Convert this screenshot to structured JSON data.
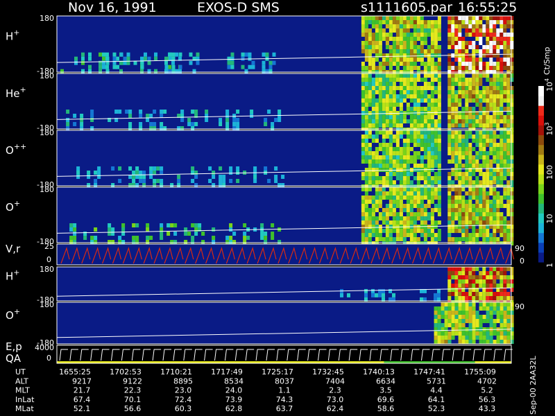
{
  "header": {
    "date": "Nov 16, 1991",
    "mission": "EXOS-D SMS",
    "file": "s1111605.par",
    "time": "16:55:25"
  },
  "colorbar": {
    "unit": "Ct/Smp",
    "ticks": [
      {
        "label": "1",
        "value": 1
      },
      {
        "label": "10",
        "value": 10
      },
      {
        "label": "100",
        "value": 100
      },
      {
        "label": "10",
        "sup": "3",
        "value": 1000
      },
      {
        "label": "10",
        "sup": "4",
        "value": 10000
      }
    ],
    "colors": [
      "#0a1b86",
      "#0a3fb6",
      "#1577d4",
      "#1cb3d8",
      "#22c9c0",
      "#23b67a",
      "#3fc12c",
      "#79d41a",
      "#b9e117",
      "#e6e81d",
      "#c9b41a",
      "#a07a12",
      "#8c4a0c",
      "#a31208",
      "#d80f0a",
      "#ee2a1a",
      "#f0f0f0",
      "#ffffff"
    ]
  },
  "footer": {
    "side_label": "Sep-00  2AA32L",
    "table": [
      {
        "name": "UT",
        "values": [
          "1655:25",
          "1702:53",
          "1710:21",
          "1717:49",
          "1725:17",
          "1732:45",
          "1740:13",
          "1747:41",
          "1755:09"
        ]
      },
      {
        "name": "ALT",
        "values": [
          "9217",
          "9122",
          "8895",
          "8534",
          "8037",
          "7404",
          "6634",
          "5731",
          "4702"
        ]
      },
      {
        "name": "MLT",
        "values": [
          "21.7",
          "22.3",
          "23.0",
          "24.0",
          "1.1",
          "2.3",
          "3.5",
          "4.4",
          "5.2"
        ]
      },
      {
        "name": "InLat",
        "values": [
          "67.4",
          "70.1",
          "72.4",
          "73.9",
          "74.3",
          "73.0",
          "69.6",
          "64.1",
          "56.3"
        ]
      },
      {
        "name": "MLat",
        "values": [
          "52.1",
          "56.6",
          "60.3",
          "62.8",
          "63.7",
          "62.4",
          "58.6",
          "52.3",
          "43.3"
        ]
      }
    ]
  },
  "chart_data": {
    "type": "heatmap",
    "x_ut_ticks": [
      "1655:25",
      "1702:53",
      "1710:21",
      "1717:49",
      "1725:17",
      "1732:45",
      "1740:13",
      "1747:41",
      "1755:09"
    ],
    "panels": [
      {
        "id": "h-plus",
        "species": "H",
        "charge": "+",
        "ytop": "180",
        "ybot": "-180",
        "bursts": [
          {
            "from": 0.0,
            "to": 0.28,
            "level": 0.3
          },
          {
            "from": 0.1,
            "to": 0.49,
            "level": 0.25
          },
          {
            "from": 0.67,
            "to": 0.84,
            "level": 0.55
          },
          {
            "from": 0.86,
            "to": 1.0,
            "level": 0.85
          }
        ]
      },
      {
        "id": "he-plus",
        "species": "He",
        "charge": "+",
        "ytop": "180",
        "ybot": "-180",
        "bursts": [
          {
            "from": 0.02,
            "to": 0.5,
            "level": 0.25
          },
          {
            "from": 0.67,
            "to": 0.84,
            "level": 0.45
          },
          {
            "from": 0.86,
            "to": 1.0,
            "level": 0.55
          }
        ]
      },
      {
        "id": "o-plus-plus",
        "species": "O",
        "charge": "++",
        "ytop": "180",
        "ybot": "-180",
        "bursts": [
          {
            "from": 0.02,
            "to": 0.5,
            "level": 0.25
          },
          {
            "from": 0.67,
            "to": 0.84,
            "level": 0.45
          },
          {
            "from": 0.86,
            "to": 1.0,
            "level": 0.5
          }
        ]
      },
      {
        "id": "o-plus",
        "species": "O",
        "charge": "+",
        "ytop": "180",
        "ybot": "-180",
        "bursts": [
          {
            "from": 0.02,
            "to": 0.5,
            "level": 0.35
          },
          {
            "from": 0.67,
            "to": 0.84,
            "level": 0.5
          },
          {
            "from": 0.86,
            "to": 1.0,
            "level": 0.55
          }
        ]
      },
      {
        "id": "vr",
        "species": "V,r",
        "charge": "",
        "ytop": "25",
        "ymid": "0",
        "right": "90",
        "rightlow": "0",
        "kind": "lines"
      },
      {
        "id": "h-plus-2",
        "species": "H",
        "charge": "+",
        "ytop": "180",
        "ybot": "-180",
        "bursts": [
          {
            "from": 0.6,
            "to": 0.84,
            "level": 0.2
          },
          {
            "from": 0.86,
            "to": 1.0,
            "level": 0.7
          }
        ]
      },
      {
        "id": "o-plus-2",
        "species": "O",
        "charge": "+",
        "ytop": "180",
        "ybot": "-180",
        "right": "90",
        "bursts": [
          {
            "from": 0.83,
            "to": 1.0,
            "level": 0.5
          }
        ]
      },
      {
        "id": "ep-qa",
        "species": "E,p",
        "species2": "QA",
        "charge": "",
        "ytop": "4000",
        "ymid": "0",
        "kind": "sweep"
      }
    ]
  }
}
